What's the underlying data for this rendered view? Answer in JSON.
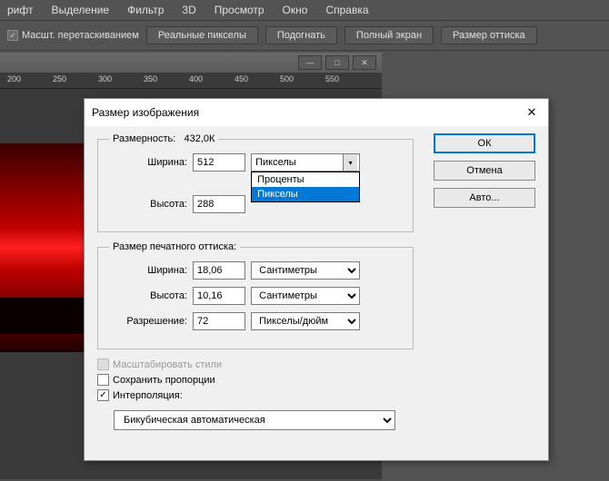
{
  "menu": [
    "рифт",
    "Выделение",
    "Фильтр",
    "3D",
    "Просмотр",
    "Окно",
    "Справка"
  ],
  "toolbar": {
    "scale_check": "Масшт. перетаскиванием",
    "buttons": [
      "Реальные пикселы",
      "Подогнать",
      "Полный экран",
      "Размер оттиска"
    ]
  },
  "ruler": [
    "200",
    "250",
    "300",
    "350",
    "400",
    "450",
    "500",
    "550"
  ],
  "dialog": {
    "title": "Размер изображения",
    "dims_label": "Размерность:",
    "dims_value": "432,0К",
    "width_label": "Ширина:",
    "width_value": "512",
    "height_label": "Высота:",
    "height_value": "288",
    "unit_selected": "Пикселы",
    "unit_options": [
      "Проценты",
      "Пикселы"
    ],
    "print_legend": "Размер печатного оттиска:",
    "print_width": "18,06",
    "print_height": "10,16",
    "print_unit": "Сантиметры",
    "res_label": "Разрешение:",
    "res_value": "72",
    "res_unit": "Пикселы/дюйм",
    "chk_styles": "Масштабировать стили",
    "chk_prop": "Сохранить пропорции",
    "chk_interp": "Интерполяция:",
    "interp_value": "Бикубическая автоматическая",
    "buttons": {
      "ok": "ОК",
      "cancel": "Отмена",
      "auto": "Авто..."
    }
  }
}
